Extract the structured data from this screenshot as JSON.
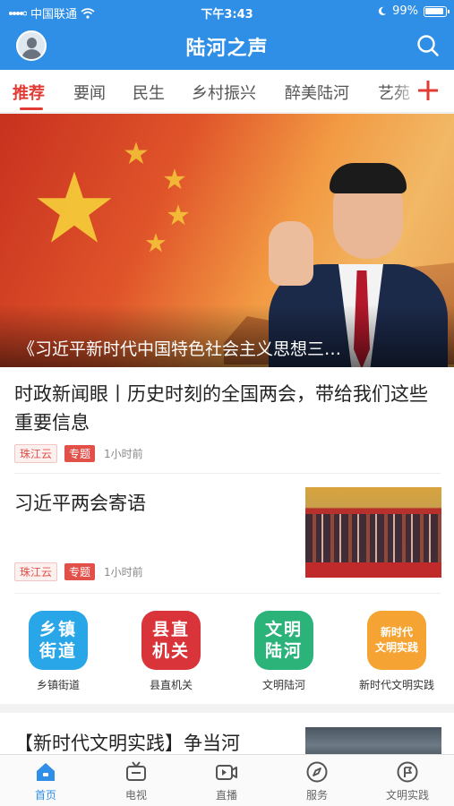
{
  "status_bar": {
    "carrier": "中国联通",
    "time": "下午3:43",
    "battery": "99%"
  },
  "header": {
    "title": "陆河之声"
  },
  "tabs": [
    {
      "label": "推荐",
      "active": true
    },
    {
      "label": "要闻"
    },
    {
      "label": "民生"
    },
    {
      "label": "乡村振兴"
    },
    {
      "label": "醉美陆河"
    },
    {
      "label": "艺苑"
    }
  ],
  "hero": {
    "caption": "《习近平新时代中国特色社会主义思想三…"
  },
  "articles": [
    {
      "title": "时政新闻眼丨历史时刻的全国两会，带给我们这些重要信息",
      "source": "珠江云",
      "topic": "专题",
      "time": "1小时前"
    },
    {
      "title": "习近平两会寄语",
      "source": "珠江云",
      "topic": "专题",
      "time": "1小时前"
    }
  ],
  "quick_entries": [
    {
      "icon_text_line1": "乡镇",
      "icon_text_line2": "街道",
      "label": "乡镇街道",
      "color": "#29a6e8"
    },
    {
      "icon_text_line1": "县直",
      "icon_text_line2": "机关",
      "label": "县直机关",
      "color": "#d9343a"
    },
    {
      "icon_text_line1": "文明",
      "icon_text_line2": "陆河",
      "label": "文明陆河",
      "color": "#2bb37a"
    },
    {
      "icon_text_line1": "新时代",
      "icon_text_line2": "文明实践",
      "label": "新时代文明实践",
      "color": "#f5a433"
    }
  ],
  "next_article": {
    "title": "【新时代文明实践】争当河"
  },
  "bottom_nav": [
    {
      "label": "首页",
      "icon": "home-icon",
      "active": true
    },
    {
      "label": "电视",
      "icon": "tv-icon"
    },
    {
      "label": "直播",
      "icon": "live-video-icon"
    },
    {
      "label": "服务",
      "icon": "compass-icon"
    },
    {
      "label": "文明实践",
      "icon": "flag-icon"
    }
  ],
  "colors": {
    "brand_blue": "#2f8fe6",
    "accent_red": "#e23b35"
  }
}
